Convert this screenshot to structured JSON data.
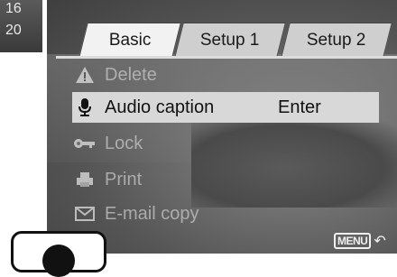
{
  "left_strip": {
    "lines": [
      "16",
      "20"
    ]
  },
  "tabs": [
    {
      "label": "Basic",
      "active": true
    },
    {
      "label": "Setup 1",
      "active": false
    },
    {
      "label": "Setup 2",
      "active": false
    }
  ],
  "menu": {
    "items": [
      {
        "label": "Delete",
        "icon": "warning-icon",
        "enabled": false,
        "value": ""
      },
      {
        "label": "Audio caption",
        "icon": "microphone-icon",
        "enabled": true,
        "selected": true,
        "value": "Enter"
      },
      {
        "label": "Lock",
        "icon": "key-icon",
        "enabled": false,
        "value": ""
      },
      {
        "label": "Print",
        "icon": "printer-icon",
        "enabled": false,
        "value": ""
      },
      {
        "label": "E-mail copy",
        "icon": "envelope-icon",
        "enabled": false,
        "value": ""
      }
    ]
  },
  "footer": {
    "menu_key_label": "MENU",
    "back_icon": "return-arrow-icon"
  },
  "colors": {
    "selected_bar": "#d8d8d8",
    "tab_active": "#f2f2f2",
    "tab_inactive": "#cfcfcf"
  }
}
